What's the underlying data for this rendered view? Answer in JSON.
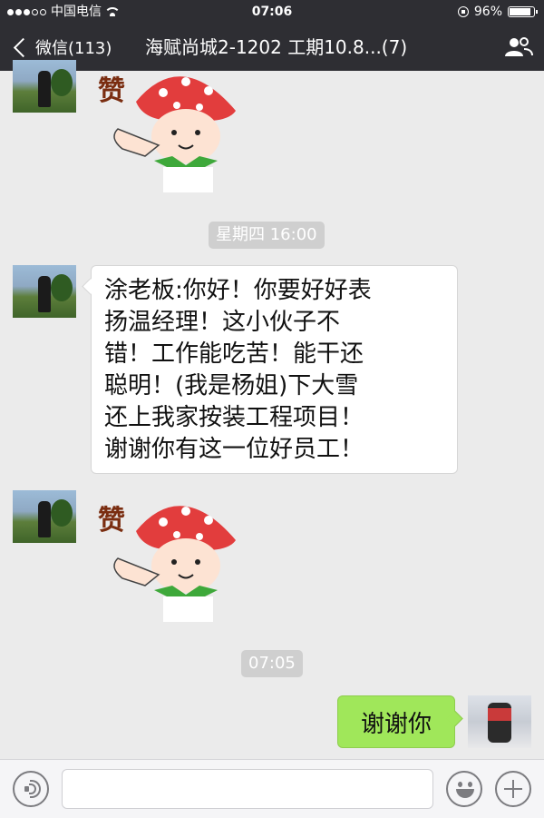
{
  "status_bar": {
    "carrier": "中国电信",
    "time": "07:06",
    "battery": "96%",
    "battery_level": 0.96,
    "signal_bars_filled": 3,
    "signal_bars_total": 5
  },
  "nav": {
    "back_label": "微信(113)",
    "title": "海赋尚城2-1202 工期10.8...(7)"
  },
  "messages": [
    {
      "type": "sticker",
      "side": "left",
      "sticker_text": "赞"
    },
    {
      "type": "time",
      "text": "星期四 16:00"
    },
    {
      "type": "text",
      "side": "left",
      "text": "涂老板:你好！你要好好表\n扬温经理！这小伙子不\n错！工作能吃苦！能干还\n聪明！(我是杨姐)下大雪\n还上我家按装工程项目！\n谢谢你有这一位好员工！"
    },
    {
      "type": "sticker",
      "side": "left",
      "sticker_text": "赞"
    },
    {
      "type": "time",
      "text": "07:05"
    },
    {
      "type": "text",
      "side": "right",
      "text": "谢谢你"
    }
  ],
  "input_bar": {
    "placeholder": ""
  },
  "colors": {
    "topbar": "#2e2e33",
    "chat_bg": "#ebebeb",
    "right_bubble": "#a0e75a",
    "time_pill": "#cfcfcf"
  }
}
